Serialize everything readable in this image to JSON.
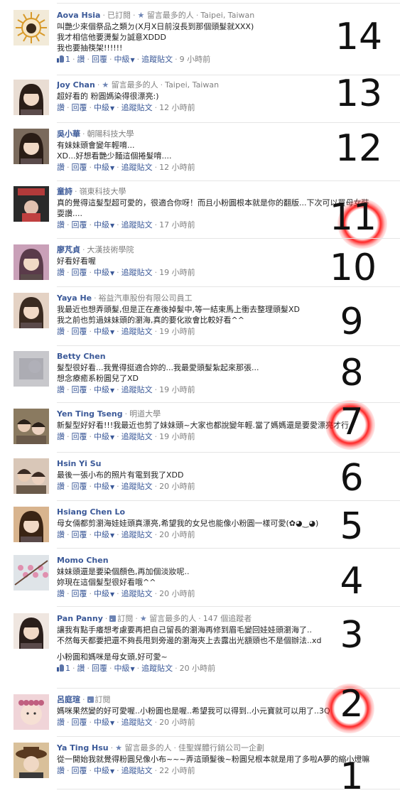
{
  "comments": [
    {
      "name": "Aova Hsia",
      "meta": [
        {
          "kind": "text",
          "text": "已訂閱"
        },
        {
          "kind": "star",
          "text": "留言最多的人"
        },
        {
          "kind": "text",
          "text": "Taipei, Taiwan"
        }
      ],
      "text": [
        "叫艷少來個祭品之類ㄉ(X月X日前沒長到那個頭髮就XXX)",
        "我才相信他要燙髮ㄉ誠意XDDD",
        "我也要抽筷架!!!!!!"
      ],
      "likes": "1",
      "actions": [
        "讚",
        "回覆",
        "中級",
        "追蹤貼文"
      ],
      "time": "9 小時前",
      "rank": "14",
      "avatar": {
        "bg": "#f2ead8",
        "fg": "#d89a2a",
        "kind": "sun"
      }
    },
    {
      "name": "Joy Chan",
      "meta": [
        {
          "kind": "star",
          "text": "留言最多的人"
        },
        {
          "kind": "text",
          "text": "Taipei, Taiwan"
        }
      ],
      "text": [
        "超好看的 粉圓媽染得很漂亮:)"
      ],
      "actions": [
        "讚",
        "回覆",
        "中級",
        "追蹤貼文"
      ],
      "time": "12 小時前",
      "rank": "13",
      "avatar": {
        "bg": "#e9ddd3",
        "fg": "#2b1e18",
        "kind": "face"
      }
    },
    {
      "name": "吳小華",
      "meta": [
        {
          "kind": "text",
          "text": "朝陽科技大學"
        }
      ],
      "text": [
        "有妹妹頭會變年輕唷...",
        "XD...好想看艷少麵這個捲髮唷...."
      ],
      "actions": [
        "讚",
        "回覆",
        "中級",
        "追蹤貼文"
      ],
      "time": "12 小時前",
      "rank": "12",
      "avatar": {
        "bg": "#7a6a5c",
        "fg": "#2a1d16",
        "kind": "face"
      }
    },
    {
      "name": "童詩",
      "meta": [
        {
          "kind": "text",
          "text": "嶺東科技大學"
        }
      ],
      "text": [
        "真的覺得這髮型超可愛的，很適合你呀！而且小粉圓根本就是你的翻版...下次可以買母女裝",
        "耍讚...."
      ],
      "actions": [
        "讚",
        "回覆",
        "中級",
        "追蹤貼文"
      ],
      "time": "17 小時前",
      "rank": "11",
      "glow": true,
      "avatar": {
        "bg": "#b23a3a",
        "fg": "#1e1e1e",
        "kind": "love"
      },
      "love": "LOVE"
    },
    {
      "name": "廖芃貞",
      "meta": [
        {
          "kind": "text",
          "text": "大漢技術學院"
        }
      ],
      "text": [
        "好看好看喔"
      ],
      "actions": [
        "讚",
        "回覆",
        "中級",
        "追蹤貼文"
      ],
      "time": "19 小時前",
      "rank": "10",
      "avatar": {
        "bg": "#c9a0b8",
        "fg": "#5a3b4a",
        "kind": "face"
      }
    },
    {
      "name": "Yaya He",
      "meta": [
        {
          "kind": "text",
          "text": "裕益汽車股份有限公司員工"
        }
      ],
      "text": [
        "我最近也想弄頭髮,但是正在產後掉髮中,等一結束馬上衝去整理頭髮XD",
        "我之前也剪過妹妹頭的瀏海,真的要化妝會比較好看^^"
      ],
      "actions": [
        "讚",
        "回覆",
        "中級",
        "追蹤貼文"
      ],
      "time": "19 小時前",
      "rank": "9",
      "avatar": {
        "bg": "#e4d2c4",
        "fg": "#3a2a20",
        "kind": "face"
      }
    },
    {
      "name": "Betty Chen",
      "meta": [],
      "text": [
        "髮型很好看...我覺得挺適合妳的...我最愛頭髮紮起來那張...",
        "想念療癒系粉圓兒了XD"
      ],
      "actions": [
        "讚",
        "回覆",
        "中級",
        "追蹤貼文"
      ],
      "time": "19 小時前",
      "rank": "8",
      "avatar": {
        "bg": "#c8c8cc",
        "fg": "#9a9aa2",
        "kind": "blur"
      }
    },
    {
      "name": "Yen Ting Tseng",
      "meta": [
        {
          "kind": "text",
          "text": "明道大學"
        }
      ],
      "text": [
        "新髮型好好看!!!我最近也剪了妹妹頭~大家也都說變年輕.當了媽媽還是要愛漂亮才行"
      ],
      "actions": [
        "讚",
        "回覆",
        "中級",
        "追蹤貼文"
      ],
      "time": "19 小時前",
      "rank": "7",
      "glow": true,
      "avatar": {
        "bg": "#8a7a60",
        "fg": "#2a2018",
        "kind": "two"
      }
    },
    {
      "name": "Hsin Yi Su",
      "meta": [],
      "text": [
        "最後一張小布的照片有電到我了XDD"
      ],
      "actions": [
        "讚",
        "回覆",
        "中級",
        "追蹤貼文"
      ],
      "time": "20 小時前",
      "rank": "6",
      "avatar": {
        "bg": "#d9c7b8",
        "fg": "#3a2a22",
        "kind": "two"
      }
    },
    {
      "name": "Hsiang Chen Lo",
      "meta": [],
      "text": [
        "母女倆都剪瀏海娃娃頭真漂亮,希望我的女兒也能像小粉圓一樣可愛(✿◕‿◕)"
      ],
      "actions": [
        "讚",
        "回覆",
        "中級",
        "追蹤貼文"
      ],
      "time": "20 小時前",
      "rank": "5",
      "avatar": {
        "bg": "#d8b48e",
        "fg": "#3a2414",
        "kind": "face"
      }
    },
    {
      "name": "Momo Chen",
      "meta": [],
      "text": [
        "妹妹頭還是要染個顏色,再加個淡妝呢..",
        "妳現在這個髮型很好看哦^^"
      ],
      "actions": [
        "讚",
        "回覆",
        "中級",
        "追蹤貼文"
      ],
      "time": "20 小時前",
      "rank": "4",
      "avatar": {
        "bg": "#dfe4e8",
        "fg": "#e07aa0",
        "kind": "flower"
      }
    },
    {
      "name": "Pan Panny",
      "meta": [
        {
          "kind": "rss",
          "text": "訂閱"
        },
        {
          "kind": "star",
          "text": "留言最多的人"
        },
        {
          "kind": "text",
          "text": "147 個追蹤者"
        }
      ],
      "text": [
        "讓我有點手癢想考慮要再把自己留長的瀏海再修到眉毛變回娃娃頭瀏海了..",
        "不然每天都要把還不夠長甩到旁邊的瀏海夾上去露出光額頭也不是個辦法..xd",
        "",
        "小粉圓和媽咪是母女頭,好可愛~"
      ],
      "likes": "1",
      "actions": [
        "讚",
        "回覆",
        "中級",
        "追蹤貼文"
      ],
      "time": "20 小時前",
      "rank": "3",
      "avatar": {
        "bg": "#efe6e0",
        "fg": "#2a1e1a",
        "kind": "face"
      }
    },
    {
      "name": "呂庭瑄",
      "meta": [
        {
          "kind": "rss",
          "text": "訂閱"
        }
      ],
      "text": [
        "媽咪果然變的好可愛喔..小粉圓也是喔..希望我可以得到..小元寶就可以用了..3Q"
      ],
      "actions": [
        "讚",
        "回覆",
        "中級",
        "追蹤貼文"
      ],
      "time": "20 小時前",
      "rank": "2",
      "glow": true,
      "avatar": {
        "bg": "#f0d4d8",
        "fg": "#c06080",
        "kind": "baby"
      }
    },
    {
      "name": "Ya Ting Hsu",
      "meta": [
        {
          "kind": "star",
          "text": "留言最多的人"
        },
        {
          "kind": "text",
          "text": "佳聖媒體行銷公司一企劃"
        }
      ],
      "text": [
        "從一開始我就覺得粉圓兒像小布~~~弄這頭髮後~粉圓兒根本就是用了多啦A夢的縮小燈嘛"
      ],
      "actions": [
        "讚",
        "回覆",
        "中級",
        "追蹤貼文"
      ],
      "time": "22 小時前",
      "rank": "1",
      "avatar": {
        "bg": "#d9c09a",
        "fg": "#5a3a20",
        "kind": "hat"
      }
    }
  ]
}
